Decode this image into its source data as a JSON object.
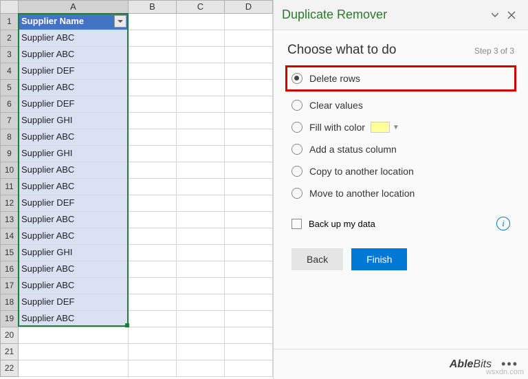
{
  "columns": [
    "A",
    "B",
    "C",
    "D"
  ],
  "table": {
    "header": "Supplier Name",
    "rows": [
      "Supplier ABC",
      "Supplier ABC",
      "Supplier DEF",
      "Supplier ABC",
      "Supplier DEF",
      "Supplier GHI",
      "Supplier ABC",
      "Supplier GHI",
      "Supplier ABC",
      "Supplier ABC",
      "Supplier DEF",
      "Supplier ABC",
      "Supplier ABC",
      "Supplier GHI",
      "Supplier ABC",
      "Supplier ABC",
      "Supplier DEF",
      "Supplier ABC"
    ],
    "empty_rows": [
      20,
      21,
      22
    ]
  },
  "pane": {
    "title": "Duplicate Remover",
    "step_title": "Choose what to do",
    "step_count": "Step 3 of 3",
    "options": {
      "delete": "Delete rows",
      "clear": "Clear values",
      "fill": "Fill with color",
      "status": "Add a status column",
      "copy": "Copy to another location",
      "move": "Move to another location"
    },
    "fill_color": "#ffff99",
    "backup_label": "Back up my data",
    "buttons": {
      "back": "Back",
      "finish": "Finish"
    },
    "brand_bold": "Able",
    "brand_thin": "Bits"
  },
  "watermark": "wsxdn.com"
}
